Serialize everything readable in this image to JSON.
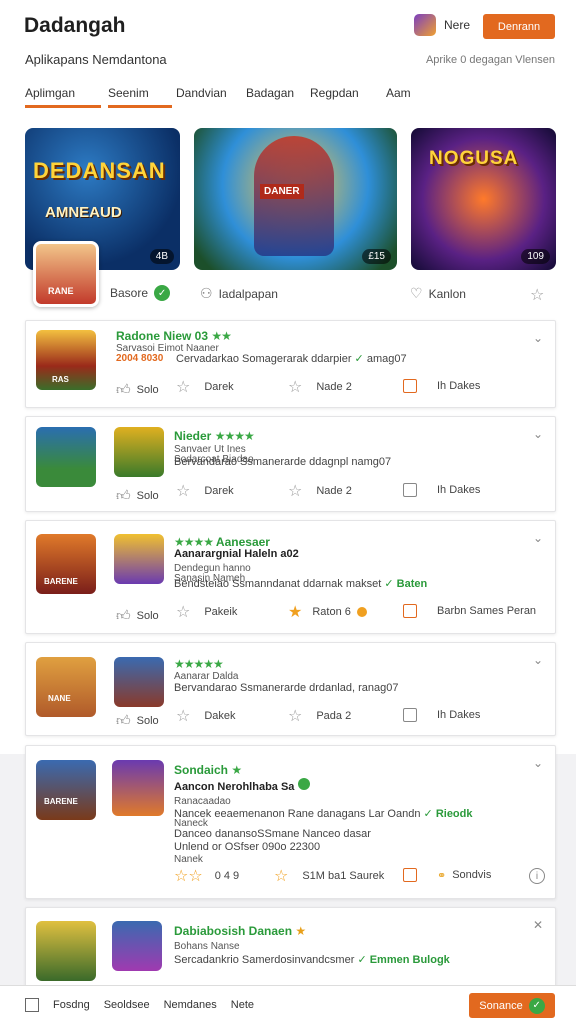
{
  "header": {
    "brand": "Dadangah",
    "user_name": "Nere",
    "button_label": "Denrann",
    "subtitle": "Aplikapans Nemdantona",
    "subtitle_right": "Aprike 0 degagan Vlensen",
    "tabs": [
      "Aplimgan",
      "Seenim",
      "Dandvian",
      "Badagan",
      "Regpdan",
      "Aam"
    ]
  },
  "featured": {
    "banners": [
      {
        "title": "DEDANSAN",
        "subtitle": "AMNEAUD",
        "badge": "4B"
      },
      {
        "title": "",
        "hero_label": "DANER",
        "badge": "£15"
      },
      {
        "title": "NOGUSA",
        "badge": "109"
      }
    ],
    "app_icon_label": "RANE",
    "row": {
      "left": "Basore",
      "middle": "Iadalpapan",
      "right": "Kanlon"
    }
  },
  "cards": [
    {
      "title": "Radone Niew 03",
      "lines": [
        "Sarvasoi Eimot Naaner",
        "2004 8030"
      ],
      "desc": "Cervadarkao Somagerarak ddarpier",
      "desc_tail": "amag07",
      "thumb_label": "RAS",
      "actions": [
        "Solo",
        "Darek",
        "Nade 2",
        "Ih Dakes"
      ]
    },
    {
      "title": "Nieder",
      "lines": [
        "Sanvaer Ut Ines",
        "Sodarcoat Biadao"
      ],
      "desc": "Bervandarao Ssmanerarde ddagnpl",
      "desc_tail": "namg07",
      "actions": [
        "Solo",
        "Darek",
        "Nade 2",
        "Ih Dakes"
      ]
    },
    {
      "title": "Aanesaer",
      "subtitle": "Aanarargnial Haleln",
      "subtitle_tail": "a02",
      "lines": [
        "Dendegun hanno",
        "Sanasin Nameh"
      ],
      "desc": "Bendsteiao Ssmanndanat ddarnak makset",
      "desc_link": "Baten",
      "thumb_label": "BARENE",
      "actions": [
        "Solo",
        "Pakeik",
        "Raton 6",
        "Barbn Sames Peran"
      ]
    },
    {
      "title": "",
      "lines": [
        "Aanarar Dalda"
      ],
      "desc": "Bervandarao Ssmanerarde drdanlad,",
      "desc_tail": "ranag07",
      "thumb_label": "NANE",
      "actions": [
        "Solo",
        "Dakek",
        "Pada 2",
        "Ih Dakes"
      ]
    },
    {
      "title": "Sondaich",
      "subtitle": "Aancon Nerohlhaba",
      "subtitle_tail": "Sa",
      "lines": [
        "Ranacaadao",
        "Naneck"
      ],
      "desc": "Nancek eeaemenanon Rane danagans Lar Oandn",
      "desc_link": "Rieodk",
      "desc2": "Danceo danansoSSmane Nanceo dasar",
      "desc3": "Unlend or OSfser 090o 22300",
      "line_tail": "Nanek",
      "thumb_label": "BARENE",
      "rating_text": "0 4 9",
      "actions": [
        "S1M ba1 Saurek",
        "Sondvis"
      ]
    },
    {
      "title": "Dabiabosish Danaen",
      "lines": [
        "Bohans Nanse"
      ],
      "desc": "Sercadankrio Samerdosinvandcsmer",
      "desc_link": "Emmen Bulogk"
    }
  ],
  "footer": {
    "items": [
      "Fosdng",
      "Seoldsee",
      "Nemdanes",
      "Nete"
    ],
    "button_label": "Sonance"
  },
  "colors": {
    "accent": "#e2691f",
    "green": "#3aa845"
  }
}
